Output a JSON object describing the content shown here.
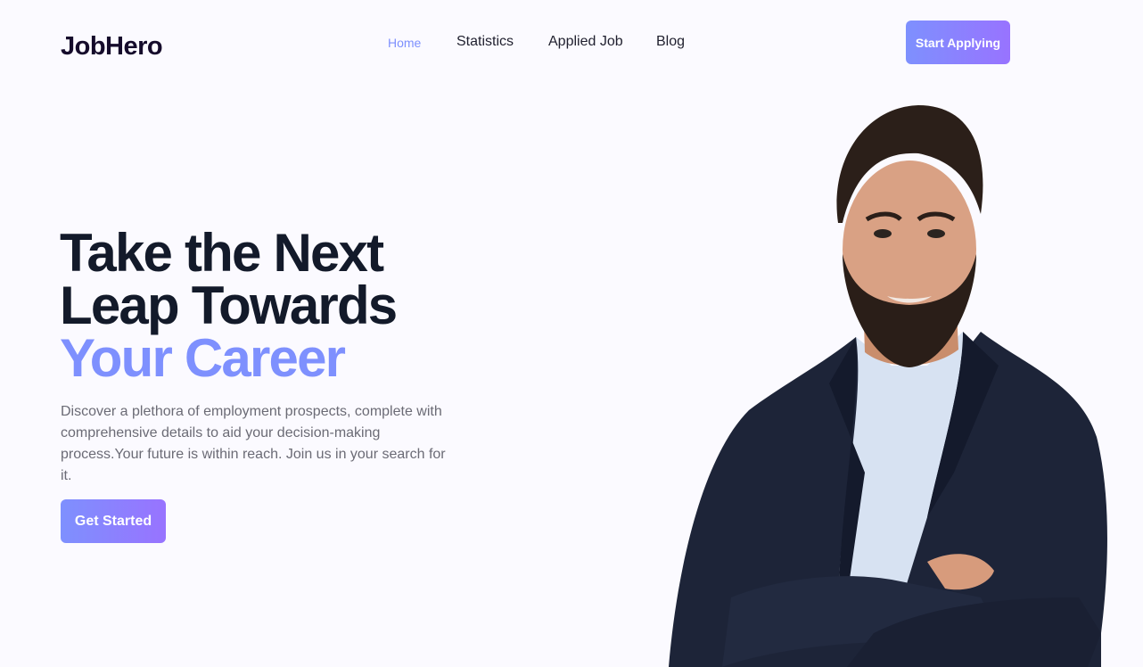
{
  "header": {
    "brand": "JobHero",
    "nav": [
      {
        "label": "Home",
        "active": true
      },
      {
        "label": "Statistics",
        "active": false
      },
      {
        "label": "Applied Job",
        "active": false
      },
      {
        "label": "Blog",
        "active": false
      }
    ],
    "cta_label": "Start Applying"
  },
  "hero": {
    "title_line1": "Take the Next",
    "title_line2": "Leap Towards",
    "title_accent": "Your Career",
    "description": "Discover a plethora of employment prospects, complete with comprehensive details to aid your decision-making process.Your future is within reach. Join us in your search for it.",
    "button_label": "Get Started"
  },
  "colors": {
    "accent": "#7e90fe",
    "accent_gradient_end": "#9873ff",
    "background": "#fbfaff",
    "heading": "#131a2a",
    "body_text": "#6b6b75"
  }
}
